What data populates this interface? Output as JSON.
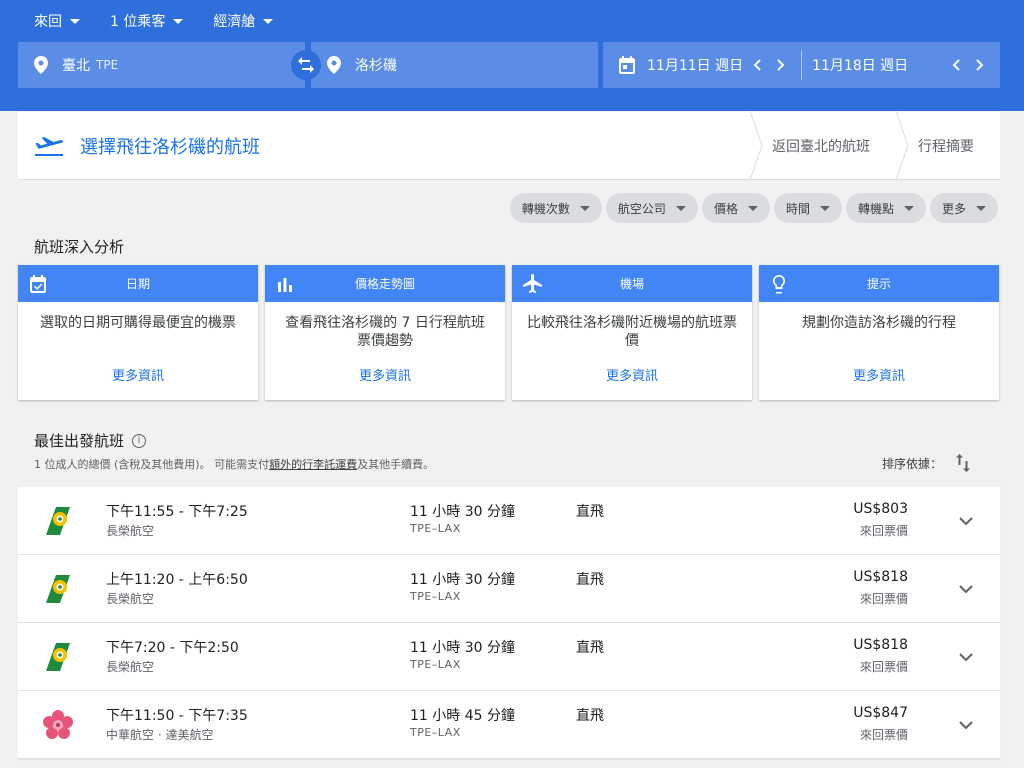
{
  "search": {
    "trip_type": "來回",
    "passengers": "1 位乘客",
    "cabin": "經濟艙",
    "origin_city": "臺北",
    "origin_code": "TPE",
    "destination_city": "洛杉磯",
    "depart_date": "11月11日 週日",
    "return_date": "11月18日 週日"
  },
  "steps": {
    "current": "選擇飛往洛杉磯的航班",
    "return": "返回臺北的航班",
    "summary": "行程摘要"
  },
  "filters": [
    "轉機次數",
    "航空公司",
    "價格",
    "時間",
    "轉機點",
    "更多"
  ],
  "insights": {
    "title": "航班深入分析",
    "cards": [
      {
        "icon": "calendar-check-icon",
        "title": "日期",
        "body": "選取的日期可購得最便宜的機票",
        "link": "更多資訊"
      },
      {
        "icon": "bar-chart-icon",
        "title": "價格走勢圖",
        "body": "查看飛往洛杉磯的 7 日行程航班票價趨勢",
        "link": "更多資訊"
      },
      {
        "icon": "airplane-icon",
        "title": "機場",
        "body": "比較飛往洛杉磯附近機場的航班票價",
        "link": "更多資訊"
      },
      {
        "icon": "lightbulb-icon",
        "title": "提示",
        "body": "規劃你造訪洛杉磯的行程",
        "link": "更多資訊"
      }
    ]
  },
  "best": {
    "title": "最佳出發航班",
    "note_prefix": "1 位成人的總價 (含稅及其他費用)。 可能需支付",
    "note_link": "額外的行李託運費",
    "note_suffix": "及其他手續費。",
    "sort_label": "排序依據："
  },
  "flights": [
    {
      "logo": "eva-air-logo",
      "times": "下午11:55 - 下午7:25",
      "airline": "長榮航空",
      "duration": "11 小時 30 分鐘",
      "route": "TPE–LAX",
      "stops": "直飛",
      "price": "US$803",
      "price_type": "來回票價"
    },
    {
      "logo": "eva-air-logo",
      "times": "上午11:20 - 上午6:50",
      "airline": "長榮航空",
      "duration": "11 小時 30 分鐘",
      "route": "TPE–LAX",
      "stops": "直飛",
      "price": "US$818",
      "price_type": "來回票價"
    },
    {
      "logo": "eva-air-logo",
      "times": "下午7:20 - 下午2:50",
      "airline": "長榮航空",
      "duration": "11 小時 30 分鐘",
      "route": "TPE–LAX",
      "stops": "直飛",
      "price": "US$818",
      "price_type": "來回票價"
    },
    {
      "logo": "china-airlines-logo",
      "times": "下午11:50 - 下午7:35",
      "airline": "中華航空 · 達美航空",
      "duration": "11 小時 45 分鐘",
      "route": "TPE–LAX",
      "stops": "直飛",
      "price": "US$847",
      "price_type": "來回票價"
    }
  ],
  "colors": {
    "header_blue": "#2f6fdc",
    "field_blue": "#5b8de6",
    "card_blue": "#4285f4",
    "link_blue": "#1a73e8"
  }
}
